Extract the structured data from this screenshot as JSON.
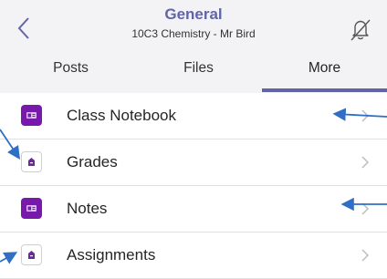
{
  "header": {
    "title": "General",
    "subtitle": "10C3 Chemistry - Mr Bird",
    "back_icon": "chevron-left-icon",
    "bell_icon": "bell-off-icon"
  },
  "tabs": [
    {
      "label": "Posts",
      "active": false
    },
    {
      "label": "Files",
      "active": false
    },
    {
      "label": "More",
      "active": true
    }
  ],
  "list": [
    {
      "label": "Class Notebook",
      "icon": "onenote-icon"
    },
    {
      "label": "Grades",
      "icon": "assignments-icon"
    },
    {
      "label": "Notes",
      "icon": "onenote-icon"
    },
    {
      "label": "Assignments",
      "icon": "assignments-icon"
    }
  ],
  "colors": {
    "accent": "#6264a7",
    "onenote": "#7719aa",
    "annotation_arrow": "#2f6fc6"
  }
}
